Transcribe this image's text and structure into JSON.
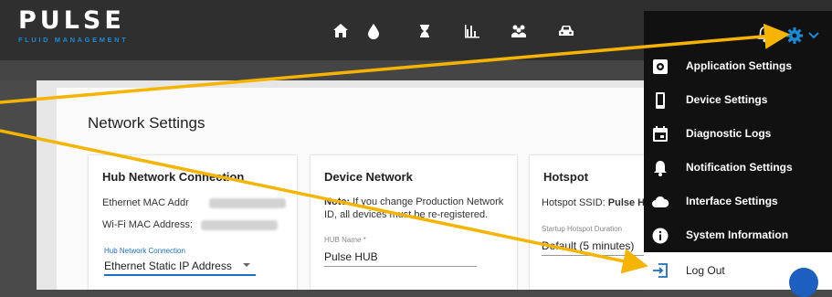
{
  "brand": {
    "name": "PULSE",
    "tagline": "FLUID MANAGEMENT"
  },
  "topnav": {
    "icons": [
      "home-icon",
      "drop-icon",
      "hourglass-icon",
      "bar-chart-icon",
      "users-icon",
      "car-icon"
    ]
  },
  "header_right": {
    "icons": [
      "bell-icon",
      "gear-icon",
      "chevron-down-icon"
    ]
  },
  "page": {
    "title": "Network Settings"
  },
  "hub_card": {
    "title": "Hub Network Connection",
    "ethernet_label": "Ethernet MAC Addr",
    "wifi_label": "Wi-Fi MAC Address:",
    "connection_label": "Hub Network Connection",
    "connection_value": "Ethernet Static IP Address"
  },
  "device_card": {
    "title": "Device Network",
    "note_bold": "Note:",
    "note_line1": " If you change Production Network",
    "note_line2": "ID, all devices must be re-registered.",
    "hub_name_label": "HUB Name *",
    "hub_name_value": "Pulse HUB"
  },
  "hotspot_card": {
    "title": "Hotspot",
    "ssid_label": "Hotspot SSID: ",
    "ssid_value": "Pulse HU",
    "duration_label": "Startup Hotspot Duration",
    "duration_value": "Default (5 minutes)"
  },
  "settings_menu": {
    "items": [
      {
        "label": "Application Settings",
        "icon": "app-settings-icon"
      },
      {
        "label": "Device Settings",
        "icon": "device-icon"
      },
      {
        "label": "Diagnostic Logs",
        "icon": "calendar-icon"
      },
      {
        "label": "Notification Settings",
        "icon": "bell-icon"
      },
      {
        "label": "Interface Settings",
        "icon": "cloud-icon"
      },
      {
        "label": "System Information",
        "icon": "info-icon"
      },
      {
        "label": "Log Out",
        "icon": "logout-icon"
      }
    ]
  },
  "colors": {
    "accent": "#1b8ad6",
    "annotation_arrow": "#f5b400",
    "menu_bg": "#111111"
  }
}
